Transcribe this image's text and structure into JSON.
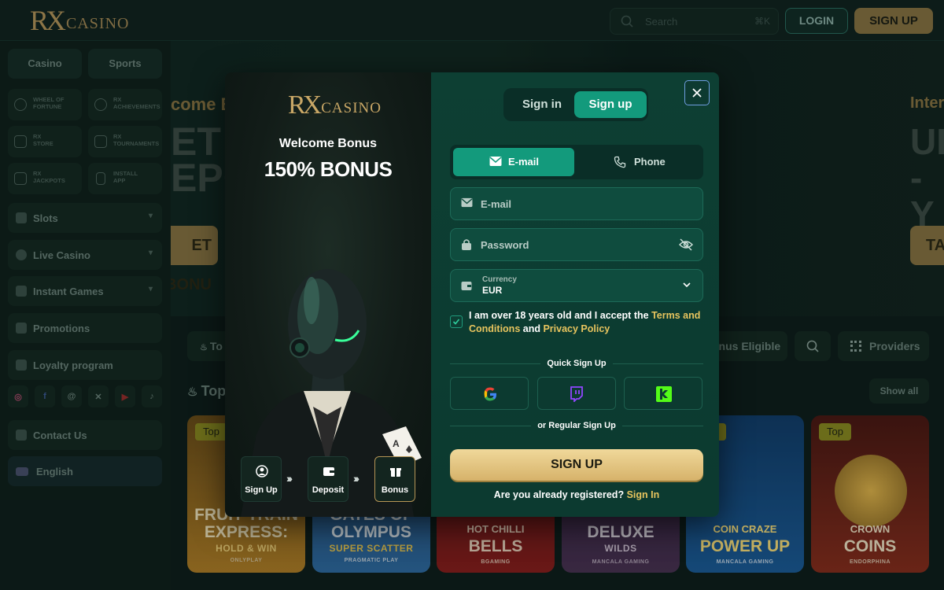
{
  "header": {
    "logo_rx": "RX",
    "logo_casino": "CASINO",
    "search_placeholder": "Search",
    "search_shortcut": "⌘K",
    "login_label": "LOGIN",
    "signup_label": "SIGN UP"
  },
  "sidebar": {
    "tabs": [
      "Casino",
      "Sports"
    ],
    "tiles": [
      {
        "line1": "WHEEL OF",
        "line2": "FORTUNE",
        "icon": "wheel-icon"
      },
      {
        "line1": "RX",
        "line2": "ACHIEVEMENTS",
        "icon": "achievements-icon"
      },
      {
        "line1": "RX",
        "line2": "STORE",
        "icon": "store-icon"
      },
      {
        "line1": "RX",
        "line2": "TOURNAMENTS",
        "icon": "trophy-icon"
      },
      {
        "line1": "RX",
        "line2": "JACKPOTS",
        "icon": "jackpot-icon"
      },
      {
        "line1": "INSTALL",
        "line2": "APP",
        "icon": "phone-icon"
      }
    ],
    "items": [
      {
        "label": "Slots",
        "chevron": true
      },
      {
        "label": "Live Casino",
        "chevron": true
      },
      {
        "label": "Instant Games",
        "chevron": true
      },
      {
        "label": "Promotions",
        "chevron": false
      },
      {
        "label": "Loyalty program",
        "chevron": false
      }
    ],
    "socials": [
      "instagram-icon",
      "facebook-icon",
      "threads-icon",
      "x-icon",
      "youtube-icon",
      "tiktok-icon"
    ],
    "contact_label": "Contact Us",
    "language_label": "English"
  },
  "hero": {
    "left_title": "come Bo",
    "left_big_1": "ET A",
    "left_big_2": "EPO",
    "left_button": "ET BONU",
    "right_title": "Inter",
    "right_big_1": "UI",
    "right_big_2": "- Y",
    "right_button": "TA"
  },
  "filters": {
    "chip_first": "To",
    "bonus_chip": "onus Eligible",
    "providers_label": "Providers"
  },
  "games_section": {
    "title": "Top",
    "show_all": "Show all",
    "badge_label": "Top",
    "games": [
      {
        "title1": "FRUIT TRAIN",
        "title2": "EXPRESS:",
        "sub": "HOLD & WIN",
        "provider": "ONLYPLAY"
      },
      {
        "title1": "GATES OF",
        "title2": "OLYMPUS",
        "sub": "SUPER SCATTER",
        "provider": "PRAGMATIC PLAY"
      },
      {
        "title1": "HOT CHILLI",
        "title2": "BELLS",
        "sub": "",
        "provider": "BGAMING"
      },
      {
        "title1": "",
        "title2": "DELUXE",
        "sub": "WILDS",
        "provider": "MANCALA GAMING"
      },
      {
        "title1": "COIN CRAZE",
        "title2": "POWER UP",
        "sub": "",
        "provider": "MANCALA GAMING"
      },
      {
        "title1": "CROWN",
        "title2": "COINS",
        "sub": "",
        "provider": "ENDORPHINA"
      }
    ]
  },
  "modal": {
    "promo": {
      "logo_rx": "RX",
      "logo_casino": "CASINO",
      "welcome_bonus": "Welcome Bonus",
      "bonus_amount": "150% BONUS",
      "steps": [
        {
          "label": "Sign Up",
          "icon": "user-icon"
        },
        {
          "label": "Deposit",
          "icon": "wallet-icon"
        },
        {
          "label": "Bonus",
          "icon": "gift-icon"
        }
      ],
      "step_arrow": "›››"
    },
    "auth_tabs": {
      "sign_in": "Sign in",
      "sign_up": "Sign up"
    },
    "method_tabs": {
      "email": "E-mail",
      "phone": "Phone"
    },
    "email_placeholder": "E-mail",
    "password_placeholder": "Password",
    "currency_label": "Currency",
    "currency_value": "EUR",
    "terms": {
      "prefix": "I am over 18 years old and I accept the",
      "terms_link": "Terms and Conditions",
      "and": "and",
      "privacy_link": "Privacy Policy",
      "checked": true
    },
    "quick_signup": "Quick Sign Up",
    "social_providers": [
      "google-icon",
      "twitch-icon",
      "kick-icon"
    ],
    "regular_signup": "or Regular Sign Up",
    "submit_label": "SIGN UP",
    "already_text": "Are you already registered?",
    "sign_in_link": "Sign In"
  },
  "colors": {
    "accent_green": "#139a7c",
    "gold": "#e7c45e",
    "form_bg": "#0d3f33"
  }
}
